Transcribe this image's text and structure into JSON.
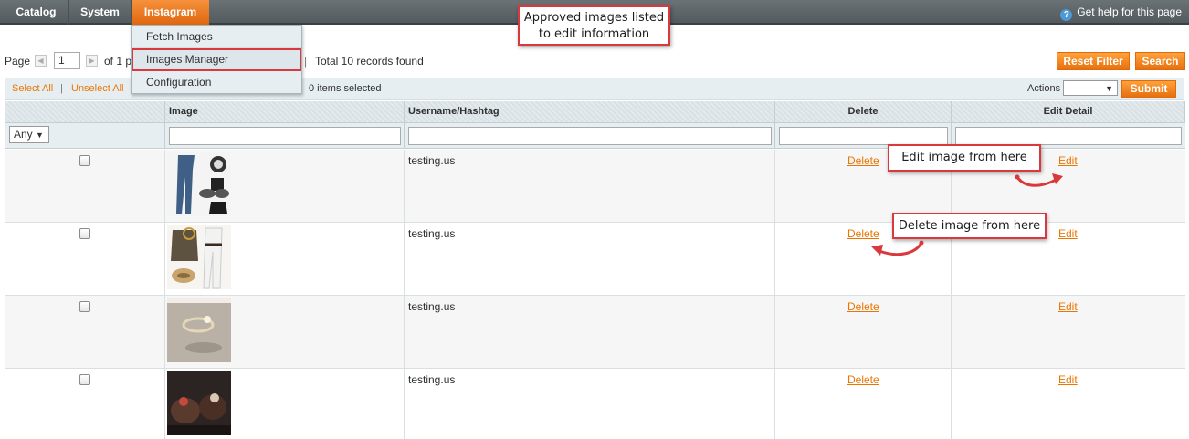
{
  "nav": {
    "items": [
      "Catalog",
      "System",
      "Instagram"
    ],
    "help": "Get help for this page"
  },
  "dropdown": {
    "items": [
      "Fetch Images",
      "Images Manager",
      "Configuration"
    ]
  },
  "pager": {
    "page_label": "Page",
    "page_value": "1",
    "of_label": "of 1 p",
    "sep": "|",
    "total": "Total 10 records found",
    "reset_filter": "Reset Filter",
    "search": "Search"
  },
  "massaction": {
    "select_all": "Select All",
    "sep": "|",
    "unselect_all": "Unselect All",
    "selected": "0 items selected",
    "actions_label": "Actions",
    "submit": "Submit"
  },
  "grid": {
    "headers": [
      "Image",
      "Username/Hashtag",
      "Delete",
      "Edit Detail"
    ],
    "filter_any": "Any",
    "rows": [
      {
        "username": "testing.us",
        "delete": "Delete",
        "edit": "Edit"
      },
      {
        "username": "testing.us",
        "delete": "Delete",
        "edit": "Edit"
      },
      {
        "username": "testing.us",
        "delete": "Delete",
        "edit": "Edit"
      },
      {
        "username": "testing.us",
        "delete": "Delete",
        "edit": "Edit"
      }
    ]
  },
  "callouts": {
    "approved_line1": "Approved images listed",
    "approved_line2": "to edit information",
    "edit": "Edit image from here",
    "delete": "Delete image from here"
  },
  "colors": {
    "accent": "#ea7601",
    "callout_border": "#d9383c",
    "nav_bg": "#5f676b"
  }
}
